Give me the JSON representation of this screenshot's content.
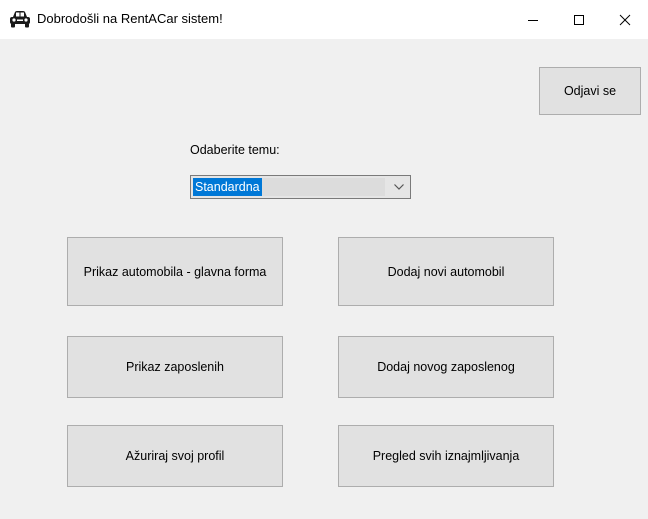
{
  "window": {
    "title": "Dobrodošli na RentACar sistem!",
    "app_icon": "car-icon",
    "controls": {
      "minimize": "minimize-icon",
      "maximize": "maximize-icon",
      "close": "close-icon"
    }
  },
  "header": {
    "logout_label": "Odjavi se"
  },
  "theme": {
    "label": "Odaberite temu:",
    "selected": "Standardna",
    "arrow": "chevron-down-icon"
  },
  "buttons": {
    "show_cars": "Prikaz automobila - glavna forma",
    "add_car": "Dodaj novi automobil",
    "show_employees": "Prikaz zaposlenih",
    "add_employee": "Dodaj novog zaposlenog",
    "update_profile": "Ažuriraj svoj profil",
    "all_rentals": "Pregled svih iznajmljivanja"
  },
  "colors": {
    "window_bg": "#f0f0f0",
    "button_bg": "#e1e1e1",
    "button_border": "#adadad",
    "selection": "#0078d7"
  }
}
